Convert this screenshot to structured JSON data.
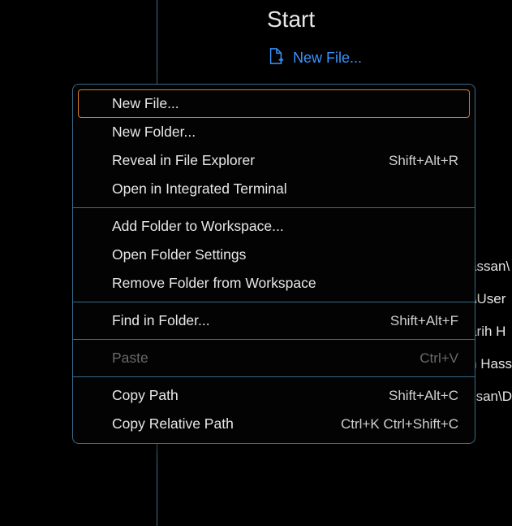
{
  "start": {
    "title": "Start",
    "newFileLabel": "New File..."
  },
  "contextMenu": {
    "items": [
      {
        "label": "New File...",
        "shortcut": "",
        "highlighted": true,
        "disabled": false
      },
      {
        "label": "New Folder...",
        "shortcut": "",
        "highlighted": false,
        "disabled": false
      },
      {
        "label": "Reveal in File Explorer",
        "shortcut": "Shift+Alt+R",
        "highlighted": false,
        "disabled": false
      },
      {
        "label": "Open in Integrated Terminal",
        "shortcut": "",
        "highlighted": false,
        "disabled": false
      },
      {
        "separator": true
      },
      {
        "label": "Add Folder to Workspace...",
        "shortcut": "",
        "highlighted": false,
        "disabled": false
      },
      {
        "label": "Open Folder Settings",
        "shortcut": "",
        "highlighted": false,
        "disabled": false
      },
      {
        "label": "Remove Folder from Workspace",
        "shortcut": "",
        "highlighted": false,
        "disabled": false
      },
      {
        "separator": true
      },
      {
        "label": "Find in Folder...",
        "shortcut": "Shift+Alt+F",
        "highlighted": false,
        "disabled": false
      },
      {
        "separator": true
      },
      {
        "label": "Paste",
        "shortcut": "Ctrl+V",
        "highlighted": false,
        "disabled": true
      },
      {
        "separator": true
      },
      {
        "label": "Copy Path",
        "shortcut": "Shift+Alt+C",
        "highlighted": false,
        "disabled": false
      },
      {
        "label": "Copy Relative Path",
        "shortcut": "Ctrl+K Ctrl+Shift+C",
        "highlighted": false,
        "disabled": false
      }
    ]
  },
  "backgroundRecents": [
    "assan\\",
    ":\\User",
    "arih H",
    "n Hass",
    "ssan\\D"
  ]
}
